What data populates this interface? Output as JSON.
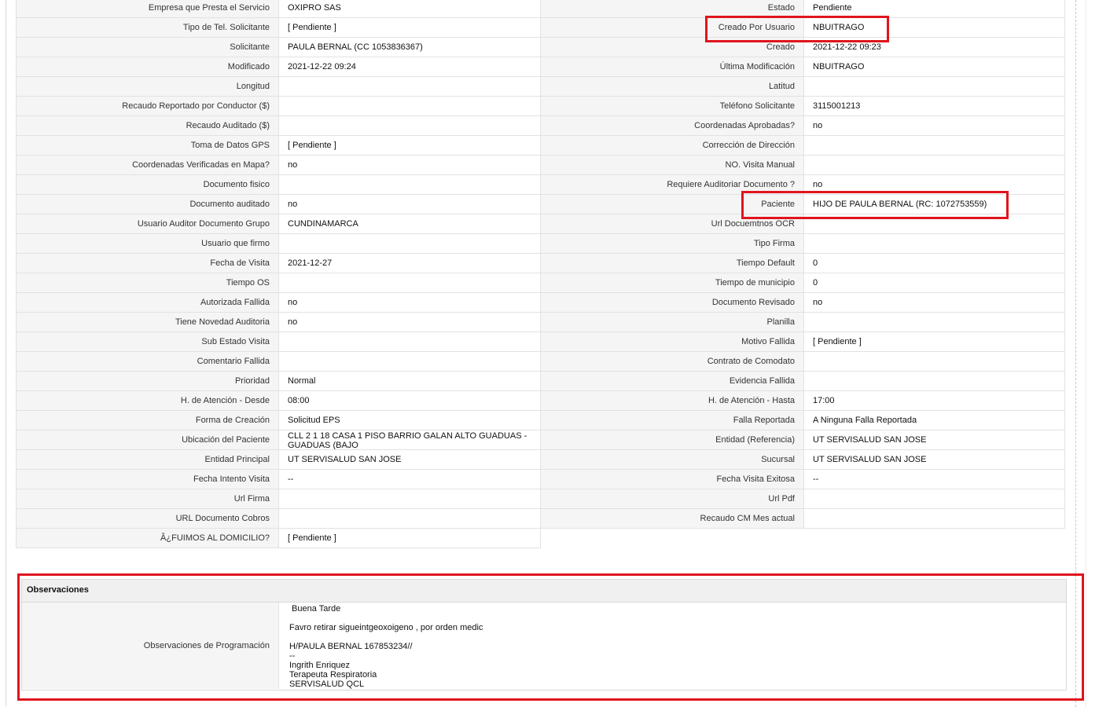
{
  "rows": [
    {
      "l1": "Empresa que Presta el Servicio",
      "v1": "OXIPRO SAS",
      "l2": "Estado",
      "v2": "Pendiente"
    },
    {
      "l1": "Tipo de Tel. Solicitante",
      "v1": "[ Pendiente ]",
      "l2": "Creado Por Usuario",
      "v2": "NBUITRAGO"
    },
    {
      "l1": "Solicitante",
      "v1": "PAULA BERNAL (CC 1053836367)",
      "l2": "Creado",
      "v2": "2021-12-22 09:23"
    },
    {
      "l1": "Modificado",
      "v1": "2021-12-22 09:24",
      "l2": "Última Modificación",
      "v2": " NBUITRAGO"
    },
    {
      "l1": "Longitud",
      "v1": "",
      "l2": "Latitud",
      "v2": ""
    },
    {
      "l1": "Recaudo Reportado por Conductor ($)",
      "v1": "",
      "l2": "Teléfono Solicitante",
      "v2": "3115001213"
    },
    {
      "l1": "Recaudo Auditado ($)",
      "v1": "",
      "l2": "Coordenadas Aprobadas?",
      "v2": " no"
    },
    {
      "l1": "Toma de Datos GPS",
      "v1": "[ Pendiente ]",
      "l2": "Corrección de Dirección",
      "v2": ""
    },
    {
      "l1": "Coordenadas Verificadas en Mapa?",
      "v1": " no",
      "l2": "NO. Visita Manual",
      "v2": ""
    },
    {
      "l1": "Documento fisico",
      "v1": "",
      "l2": "Requiere Auditoriar Documento ?",
      "v2": " no"
    },
    {
      "l1": "Documento auditado",
      "v1": "no",
      "l2": "Paciente",
      "v2": "HIJO DE PAULA BERNAL (RC: 1072753559)"
    },
    {
      "l1": "Usuario Auditor Documento Grupo",
      "v1": "CUNDINAMARCA",
      "l2": "Url Docuemtnos OCR",
      "v2": ""
    },
    {
      "l1": "Usuario que firmo",
      "v1": "",
      "l2": "Tipo Firma",
      "v2": ""
    },
    {
      "l1": "Fecha de Visita",
      "v1": " 2021-12-27",
      "l2": "Tiempo Default",
      "v2": "0"
    },
    {
      "l1": "Tiempo OS",
      "v1": "",
      "l2": "Tiempo de municipio",
      "v2": "0"
    },
    {
      "l1": "Autorizada Fallida",
      "v1": "no",
      "l2": "Documento Revisado",
      "v2": " no"
    },
    {
      "l1": "Tiene Novedad Auditoria",
      "v1": "no",
      "l2": "Planilla",
      "v2": ""
    },
    {
      "l1": "Sub Estado Visita",
      "v1": "",
      "l2": "Motivo Fallida",
      "v2": "[ Pendiente ]"
    },
    {
      "l1": "Comentario Fallida",
      "v1": "",
      "l2": "Contrato de Comodato",
      "v2": ""
    },
    {
      "l1": "Prioridad",
      "v1": "Normal",
      "l2": "Evidencia Fallida",
      "v2": ""
    },
    {
      "l1": "H. de Atención - Desde",
      "v1": "08:00",
      "l2": "H. de Atención - Hasta",
      "v2": "17:00"
    },
    {
      "l1": "Forma de Creación",
      "v1": "Solicitud EPS",
      "l2": "Falla Reportada",
      "v2": "A Ninguna Falla Reportada"
    },
    {
      "l1": "Ubicación del Paciente",
      "v1": "CLL 2 1 18 CASA 1 PISO BARRIO GALAN ALTO GUADUAS - GUADUAS (BAJO",
      "l2": "Entidad (Referencia)",
      "v2": "UT SERVISALUD SAN JOSE"
    },
    {
      "l1": "Entidad Principal",
      "v1": "UT SERVISALUD SAN JOSE",
      "l2": "Sucursal",
      "v2": "UT SERVISALUD SAN JOSE"
    },
    {
      "l1": "Fecha Intento Visita",
      "v1": "--",
      "l2": "Fecha Visita Exitosa",
      "v2": "--"
    },
    {
      "l1": "Url Firma",
      "v1": "",
      "l2": "Url Pdf",
      "v2": ""
    },
    {
      "l1": "URL Documento Cobros",
      "v1": "",
      "l2": "Recaudo CM Mes actual",
      "v2": ""
    },
    {
      "l1": "Â¿FUIMOS AL DOMICILIO?",
      "v1": "[ Pendiente ]",
      "l2": null,
      "v2": null
    }
  ],
  "observaciones": {
    "title": "Observaciones",
    "label": "Observaciones de Programación",
    "lines": [
      " Buena Tarde",
      "",
      "Favro retirar sigueintgeoxoigeno , por orden medic",
      "",
      "H/PAULA BERNAL 167853234//",
      "--",
      "Ingrith Enriquez",
      "Terapeuta Respiratoria",
      "SERVISALUD QCL"
    ]
  },
  "highlight_color": "#e0141d"
}
